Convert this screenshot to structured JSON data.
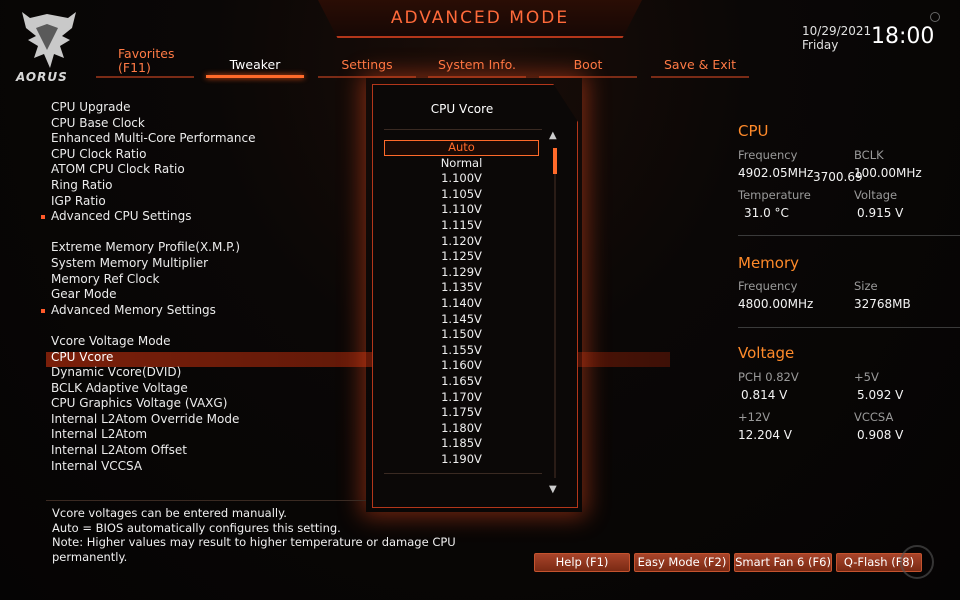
{
  "header": {
    "mode_title": "ADVANCED MODE",
    "logo_text": "AORUS",
    "date": "10/29/2021",
    "day": "Friday",
    "time": "18:00"
  },
  "tabs": [
    {
      "label": "Favorites",
      "sub": "(F11)",
      "active": false
    },
    {
      "label": "Tweaker",
      "active": true
    },
    {
      "label": "Settings",
      "active": false
    },
    {
      "label": "System Info.",
      "active": false
    },
    {
      "label": "Boot",
      "active": false
    },
    {
      "label": "Save & Exit",
      "active": false
    }
  ],
  "menu": {
    "group1": [
      {
        "label": "CPU Upgrade",
        "submenu": false
      },
      {
        "label": "CPU Base Clock",
        "submenu": false
      },
      {
        "label": "Enhanced Multi-Core Performance",
        "submenu": false
      },
      {
        "label": "CPU Clock Ratio",
        "submenu": false
      },
      {
        "label": "ATOM CPU Clock Ratio",
        "submenu": false
      },
      {
        "label": "Ring Ratio",
        "submenu": false
      },
      {
        "label": "IGP Ratio",
        "submenu": false
      },
      {
        "label": "Advanced CPU Settings",
        "submenu": true
      }
    ],
    "group2": [
      {
        "label": "Extreme Memory Profile(X.M.P.)",
        "submenu": false
      },
      {
        "label": "System Memory Multiplier",
        "submenu": false
      },
      {
        "label": "Memory Ref Clock",
        "submenu": false
      },
      {
        "label": "Gear Mode",
        "submenu": false
      },
      {
        "label": "Advanced Memory Settings",
        "submenu": true
      }
    ],
    "group3": [
      {
        "label": "Vcore Voltage Mode",
        "submenu": false
      },
      {
        "label": "CPU Vcore",
        "submenu": false,
        "selected": true
      },
      {
        "label": "Dynamic Vcore(DVID)",
        "submenu": false
      },
      {
        "label": "BCLK Adaptive Voltage",
        "submenu": false
      },
      {
        "label": "CPU Graphics Voltage (VAXG)",
        "submenu": false
      },
      {
        "label": "Internal L2Atom Override Mode",
        "submenu": false
      },
      {
        "label": "Internal L2Atom",
        "submenu": false
      },
      {
        "label": "Internal L2Atom Offset",
        "submenu": false
      },
      {
        "label": "Internal VCCSA",
        "submenu": false
      }
    ]
  },
  "popup": {
    "title": "CPU Vcore",
    "selected": "Auto",
    "options": [
      "Auto",
      "Normal",
      "1.100V",
      "1.105V",
      "1.110V",
      "1.115V",
      "1.120V",
      "1.125V",
      "1.129V",
      "1.135V",
      "1.140V",
      "1.145V",
      "1.150V",
      "1.155V",
      "1.160V",
      "1.165V",
      "1.170V",
      "1.175V",
      "1.180V",
      "1.185V",
      "1.190V"
    ]
  },
  "cpu": {
    "title": "CPU",
    "freq_label": "Frequency",
    "freq_value": "4902.05MHz",
    "freq_small": "3700.69",
    "bclk_label": "BCLK",
    "bclk_value": "100.00MHz",
    "temp_label": "Temperature",
    "temp_value": "31.0 °C",
    "volt_label": "Voltage",
    "volt_value": "0.915 V"
  },
  "memory": {
    "title": "Memory",
    "freq_label": "Frequency",
    "freq_value": "4800.00MHz",
    "size_label": "Size",
    "size_value": "32768MB"
  },
  "voltage": {
    "title": "Voltage",
    "pch_label": "PCH 0.82V",
    "pch_value": "0.814 V",
    "v5_label": "+5V",
    "v5_value": "5.092 V",
    "v12_label": "+12V",
    "v12_value": "12.204 V",
    "vccsa_label": "VCCSA",
    "vccsa_value": "0.908 V"
  },
  "help": {
    "line1": "Vcore voltages can be entered manually.",
    "line2": "Auto = BIOS automatically configures this setting.",
    "line3": "Note: Higher values may result to higher temperature or damage CPU",
    "line4": "permanently."
  },
  "buttons": {
    "help": "Help (F1)",
    "easy": "Easy Mode (F2)",
    "fan": "Smart Fan 6 (F6)",
    "qflash": "Q-Flash (F8)"
  },
  "colors": {
    "accent": "#ff6a2a",
    "panel_title": "#ff8a2a"
  }
}
